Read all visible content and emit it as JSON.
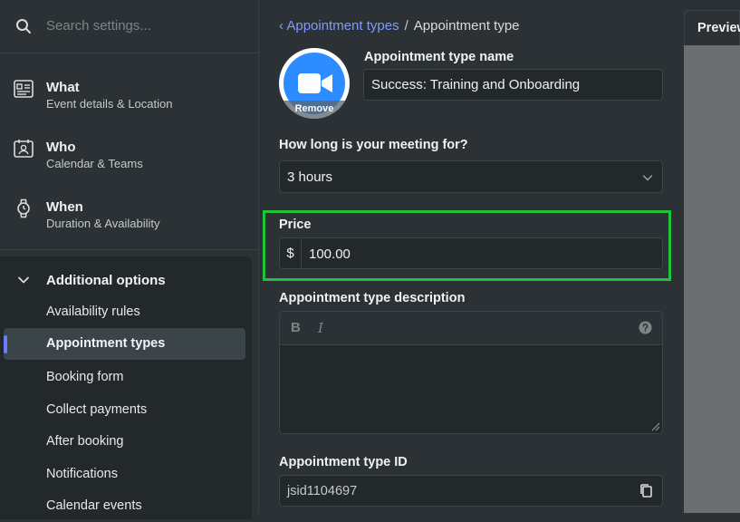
{
  "search": {
    "placeholder": "Search settings..."
  },
  "nav": [
    {
      "title": "What",
      "subtitle": "Event details & Location",
      "icon": "id-card-icon"
    },
    {
      "title": "Who",
      "subtitle": "Calendar & Teams",
      "icon": "contact-calendar-icon"
    },
    {
      "title": "When",
      "subtitle": "Duration & Availability",
      "icon": "watch-icon"
    }
  ],
  "additional": {
    "title": "Additional options",
    "items": [
      {
        "label": "Availability rules",
        "active": false
      },
      {
        "label": "Appointment types",
        "active": true
      },
      {
        "label": "Booking form",
        "active": false
      },
      {
        "label": "Collect payments",
        "active": false
      },
      {
        "label": "After booking",
        "active": false
      },
      {
        "label": "Notifications",
        "active": false
      },
      {
        "label": "Calendar events",
        "active": false
      }
    ]
  },
  "breadcrumb": {
    "parent": "Appointment types",
    "separator": "/",
    "current": "Appointment type"
  },
  "avatar": {
    "remove_label": "Remove",
    "icon": "video-camera-icon",
    "bg_color": "#2d8cff"
  },
  "form": {
    "name_label": "Appointment type name",
    "name_value": "Success: Training and Onboarding",
    "duration_label": "How long is your meeting for?",
    "duration_value": "3 hours",
    "price_label": "Price",
    "currency_symbol": "$",
    "price_value": "100.00",
    "description_label": "Appointment type description",
    "bold_label": "B",
    "italic_label": "I",
    "id_label": "Appointment type ID",
    "id_value": "jsid1104697"
  },
  "preview": {
    "title": "Preview"
  },
  "colors": {
    "highlight": "#1fc33a",
    "link": "#7e9cf7",
    "active_bar": "#6b7cff"
  }
}
